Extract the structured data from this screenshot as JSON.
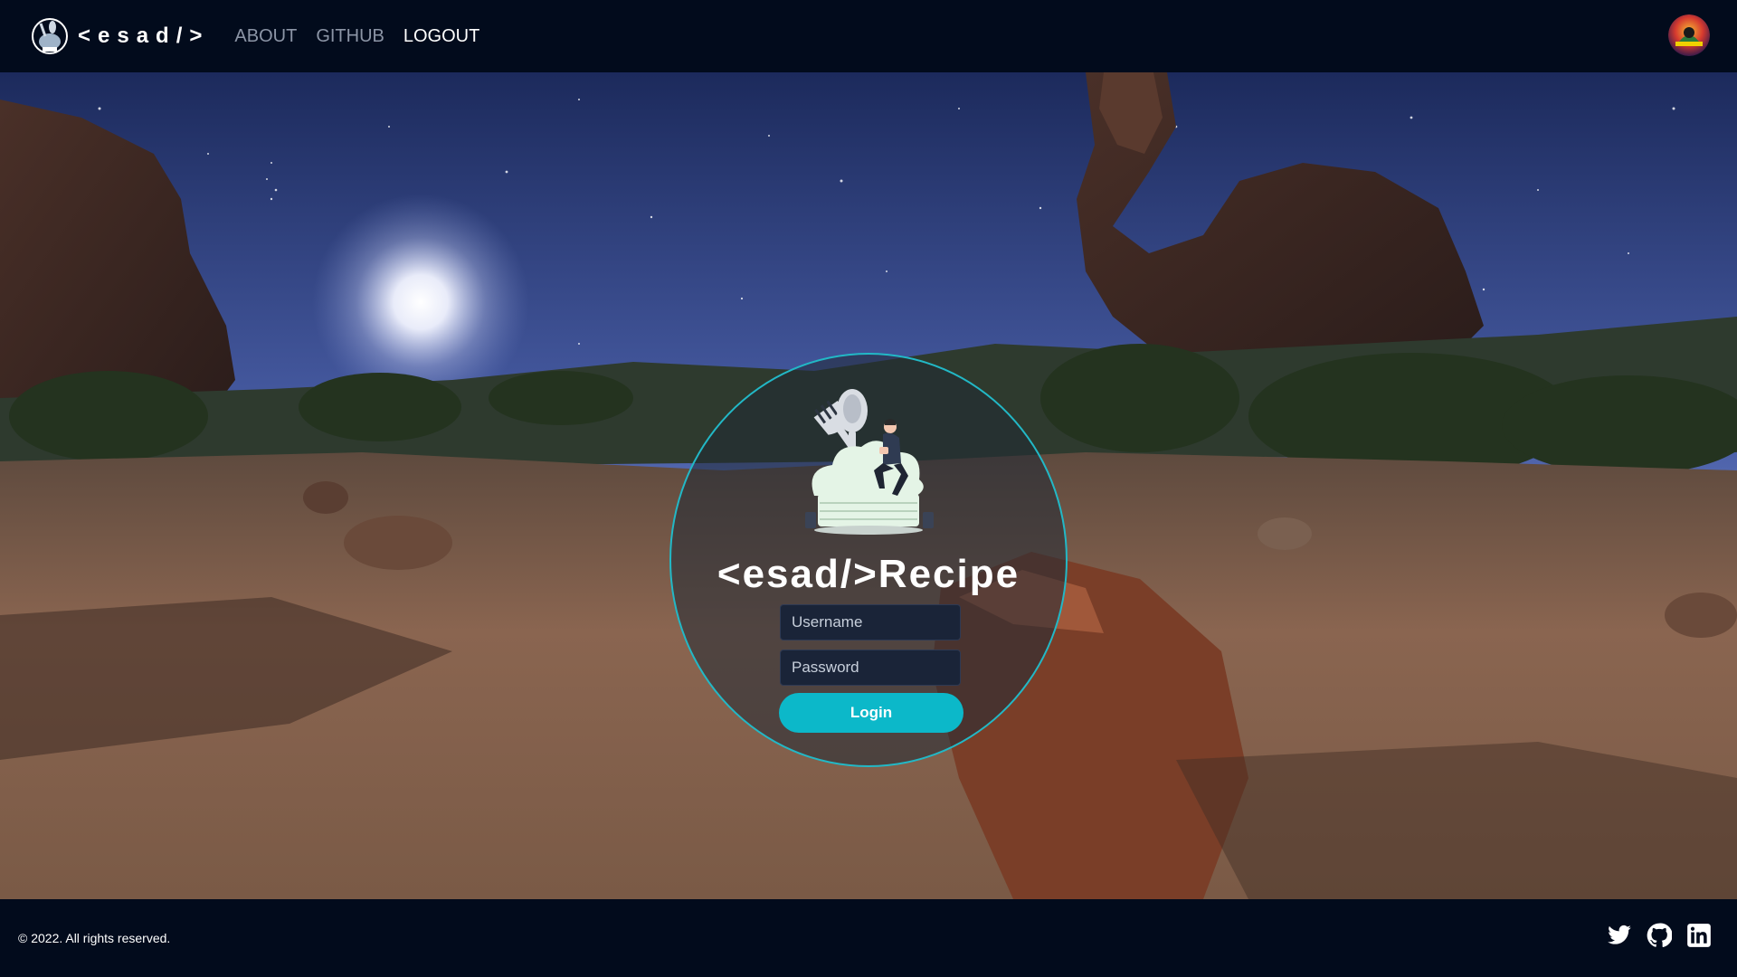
{
  "header": {
    "brand_text": "<esad/>",
    "nav": [
      {
        "label": "ABOUT"
      },
      {
        "label": "GITHUB"
      },
      {
        "label": "LOGOUT"
      }
    ]
  },
  "login": {
    "title": "<esad/>Recipe",
    "username_placeholder": "Username",
    "password_placeholder": "Password",
    "button_label": "Login"
  },
  "footer": {
    "copyright": "© 2022. All rights reserved.",
    "social_icons": [
      "twitter-icon",
      "github-icon",
      "linkedin-icon"
    ]
  },
  "colors": {
    "nav_background": "#020b1c",
    "accent": "#0cb8c9",
    "input_background": "#1a2438",
    "nav_inactive": "#8c95a6"
  }
}
